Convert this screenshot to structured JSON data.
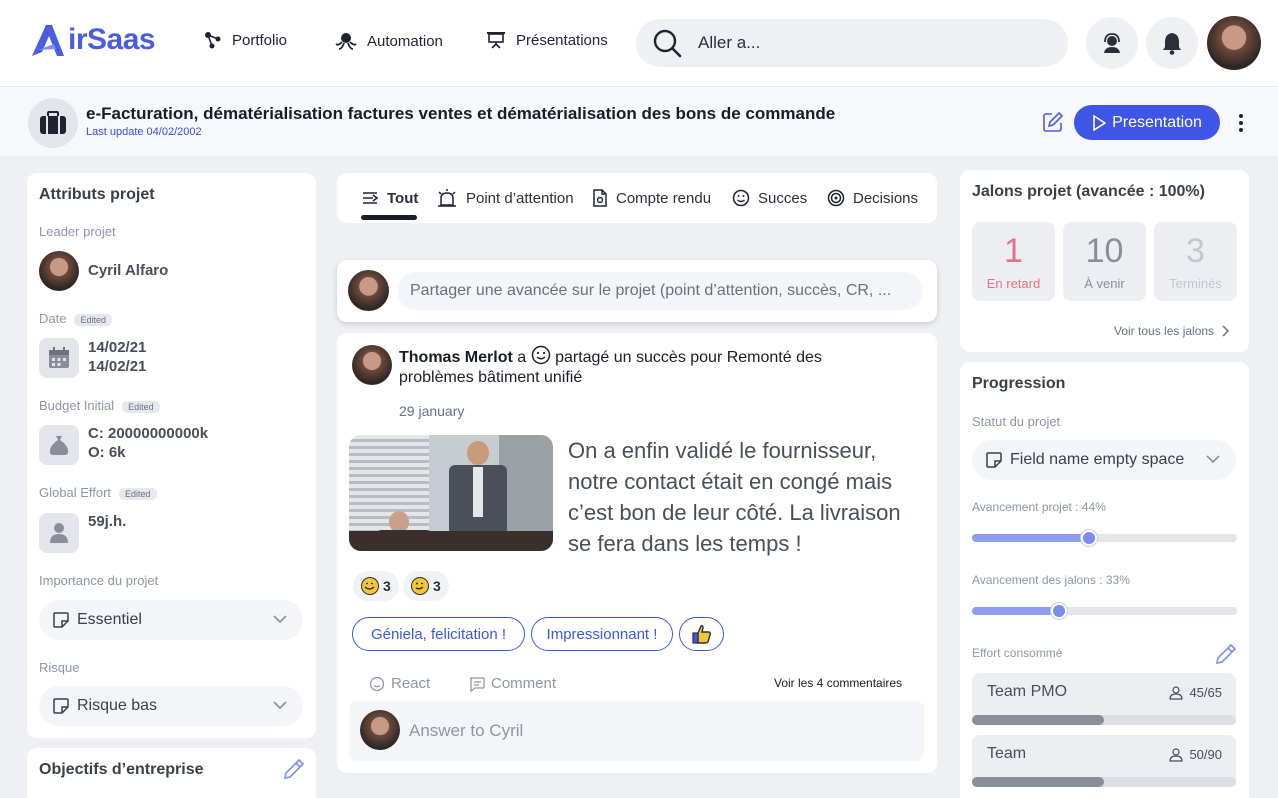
{
  "nav": {
    "logo": "AirSaas",
    "items": [
      "Portfolio",
      "Automation",
      "Présentations"
    ],
    "search_placeholder": "Aller a..."
  },
  "project": {
    "title": "e-Facturation, dématérialisation factures ventes et dématérialisation  des bons de commande",
    "last_update": "Last update 04/02/2002",
    "presentation_label": "Presentation"
  },
  "attributes": {
    "title": "Attributs projet",
    "leader_label": "Leader projet",
    "leader_name": "Cyril Alfaro",
    "date_label": "Date",
    "date_badge": "Edited",
    "date_start": "14/02/21",
    "date_end": "14/02/21",
    "budget_label": "Budget Initial",
    "budget_badge": "Edited",
    "budget_c": "C: 20000000000k",
    "budget_o": "O: 6k",
    "effort_label": "Global Effort",
    "effort_badge": "Edited",
    "effort_value": "59j.h.",
    "importance_label": "Importance du projet",
    "importance_value": "Essentiel",
    "risk_label": "Risque",
    "risk_value": "Risque bas"
  },
  "objectives": {
    "title": "Objectifs d’entreprise"
  },
  "tabs": [
    "Tout",
    "Point d’attention",
    "Compte rendu",
    "Succes",
    "Decisions"
  ],
  "share": {
    "placeholder": "Partager une avancée sur le projet (point d’attention, succès, CR, ..."
  },
  "post": {
    "author": "Thomas Merlot",
    "action_pre": "a",
    "action": "partagé un succès pour Remonté des problèmes bâtiment unifié",
    "date": "29 january",
    "body": "On a enfin validé le fournisseur, notre contact était en congé mais c’est bon de leur côté. La livraison se fera dans les temps !",
    "reactions": [
      {
        "icon": "smile-grin-emoji",
        "count": "3"
      },
      {
        "icon": "wink-emoji",
        "count": "3"
      }
    ],
    "quick_replies": [
      "Géniela, felicitation !",
      "Impressionnant !"
    ],
    "react_label": "React",
    "comment_label": "Comment",
    "see_comments": "Voir les 4 commentaires",
    "answer_placeholder": "Answer to Cyril"
  },
  "milestones": {
    "title": "Jalons projet (avancée : 100%)",
    "stats": [
      {
        "value": "1",
        "label": "En retard",
        "color": "#e8708a"
      },
      {
        "value": "10",
        "label": "À venir",
        "color": "#8a8e99"
      },
      {
        "value": "3",
        "label": "Terminés",
        "color": "#c4c7cf"
      }
    ],
    "see_all": "Voir tous les jalons"
  },
  "progress": {
    "title": "Progression",
    "status_label": "Statut du projet",
    "status_value": "Field name empty space",
    "project_adv_label": "Avancement projet : 44%",
    "project_adv": 0.44,
    "milestone_adv_label": "Avancement des jalons : 33%",
    "milestone_adv": 0.33,
    "effort_label": "Effort consommé",
    "efforts": [
      {
        "name": "Team PMO",
        "count": "45/65",
        "ratio": 0.5
      },
      {
        "name": "Team",
        "count": "50/90",
        "ratio": 0.5
      }
    ]
  },
  "colors": {
    "accent": "#3e55e6",
    "late": "#e8708a"
  }
}
